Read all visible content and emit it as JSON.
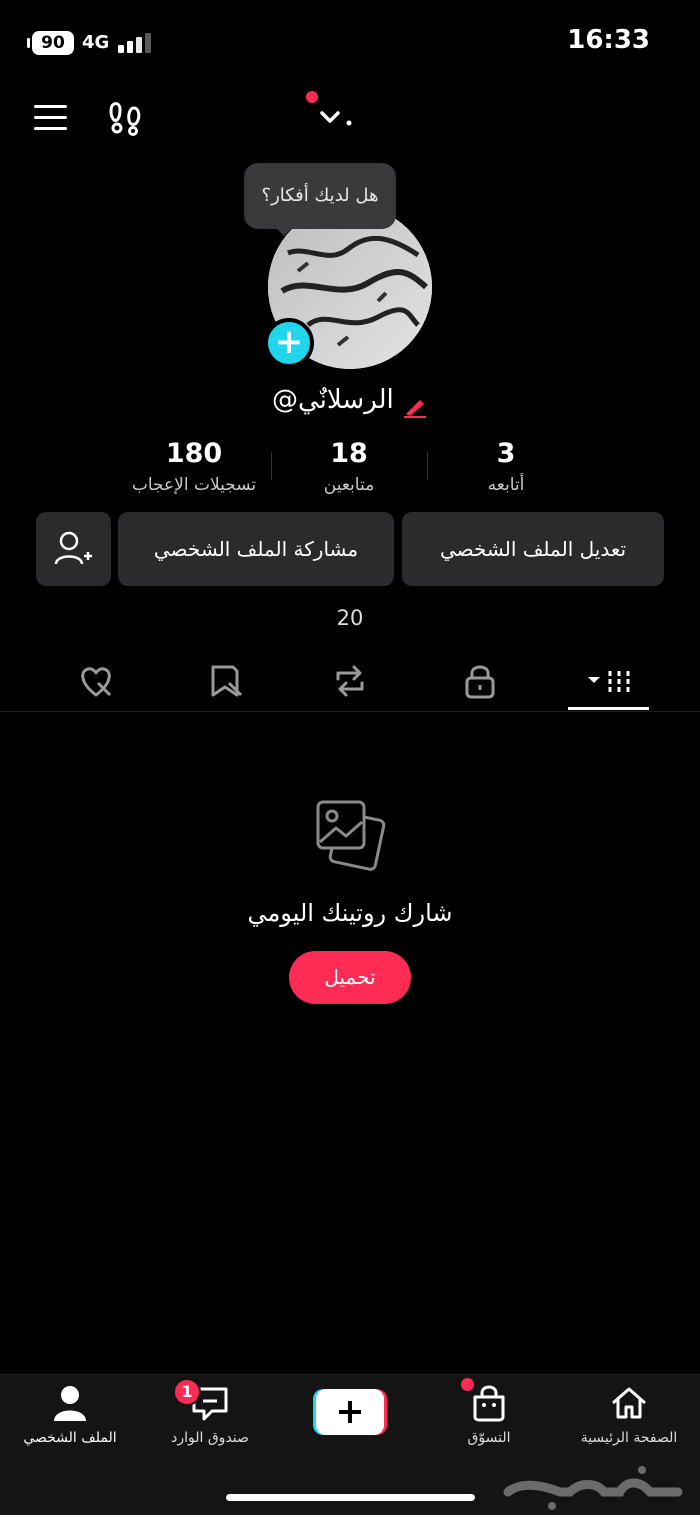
{
  "status_bar": {
    "battery": "90",
    "network": "4G",
    "time": "16:33"
  },
  "header": {
    "tooltip": "هل لديك أفكار؟"
  },
  "profile": {
    "username": "@الرسلانٌي"
  },
  "stats": [
    {
      "value": "3",
      "label": "أتابعه"
    },
    {
      "value": "18",
      "label": "متابعين"
    },
    {
      "value": "180",
      "label": "تسجيلات الإعجاب"
    }
  ],
  "buttons": {
    "edit_profile": "تعديل الملف الشخصي",
    "share_profile": "مشاركة الملف الشخصي"
  },
  "videos_count": "20",
  "tabs": [
    "videos-grid-icon",
    "lock-icon",
    "repost-icon",
    "favorites-icon",
    "liked-icon"
  ],
  "empty_state": {
    "text": "شارك روتينك اليومي",
    "button": "تحميل"
  },
  "bottom_nav": {
    "home": "الصفحة الرئيسية",
    "shop": "التسوّق",
    "inbox": "صندوق الوارد",
    "inbox_badge": "1",
    "profile": "الملف الشخصي"
  },
  "watermark": "حراج",
  "colors": {
    "accent": "#fe2c55",
    "cyan": "#20d5ec",
    "button_bg": "#2b2b2d"
  }
}
